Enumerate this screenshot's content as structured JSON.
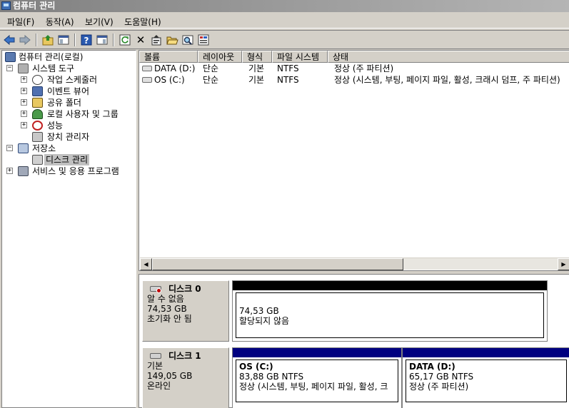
{
  "window": {
    "title": "컴퓨터 관리"
  },
  "menu": [
    "파일(F)",
    "동작(A)",
    "보기(V)",
    "도움말(H)"
  ],
  "toolbar": {
    "back_icon": "arrow-left-icon",
    "forward_icon": "arrow-right-icon",
    "delete_glyph": "✕"
  },
  "tree": {
    "root": "컴퓨터 관리(로컬)",
    "system_tools": "시스템 도구",
    "task_scheduler": "작업 스케줄러",
    "event_viewer": "이벤트 뷰어",
    "shared_folders": "공유 폴더",
    "local_users": "로컬 사용자 및 그룹",
    "performance": "성능",
    "device_manager": "장치 관리자",
    "storage": "저장소",
    "disk_management": "디스크 관리",
    "services_apps": "서비스 및 응용 프로그램",
    "expand_plus": "+",
    "expand_minus": "−"
  },
  "volume_list": {
    "columns": [
      "볼륨",
      "레이아웃",
      "형식",
      "파일 시스템",
      "상태"
    ],
    "rows": [
      {
        "volume": "DATA (D:)",
        "layout": "단순",
        "type": "기본",
        "fs": "NTFS",
        "status": "정상 (주 파티션)"
      },
      {
        "volume": "OS (C:)",
        "layout": "단순",
        "type": "기본",
        "fs": "NTFS",
        "status": "정상 (시스템, 부팅, 페이지 파일, 활성, 크래시 덤프, 주 파티션)"
      }
    ]
  },
  "scroll": {
    "left_arrow": "◀",
    "right_arrow": "▶"
  },
  "disks": [
    {
      "name": "디스크 0",
      "line1": "알 수 없음",
      "line2": "74,53 GB",
      "line3": "초기화 안 됨",
      "partition": {
        "size": "74,53 GB",
        "status": "할당되지 않음"
      }
    },
    {
      "name": "디스크 1",
      "line1": "기본",
      "line2": "149,05 GB",
      "line3": "온라인",
      "partitions": [
        {
          "name": "OS  (C:)",
          "size": "83,88 GB NTFS",
          "status": "정상 (시스템, 부팅, 페이지 파일, 활성, 크"
        },
        {
          "name": "DATA  (D:)",
          "size": "65,17 GB NTFS",
          "status": "정상 (주 파티션)"
        }
      ]
    }
  ],
  "colors": {
    "unallocated_bar": "#000000",
    "primary_bar": "#000080",
    "selection": "#c0c0c0"
  }
}
